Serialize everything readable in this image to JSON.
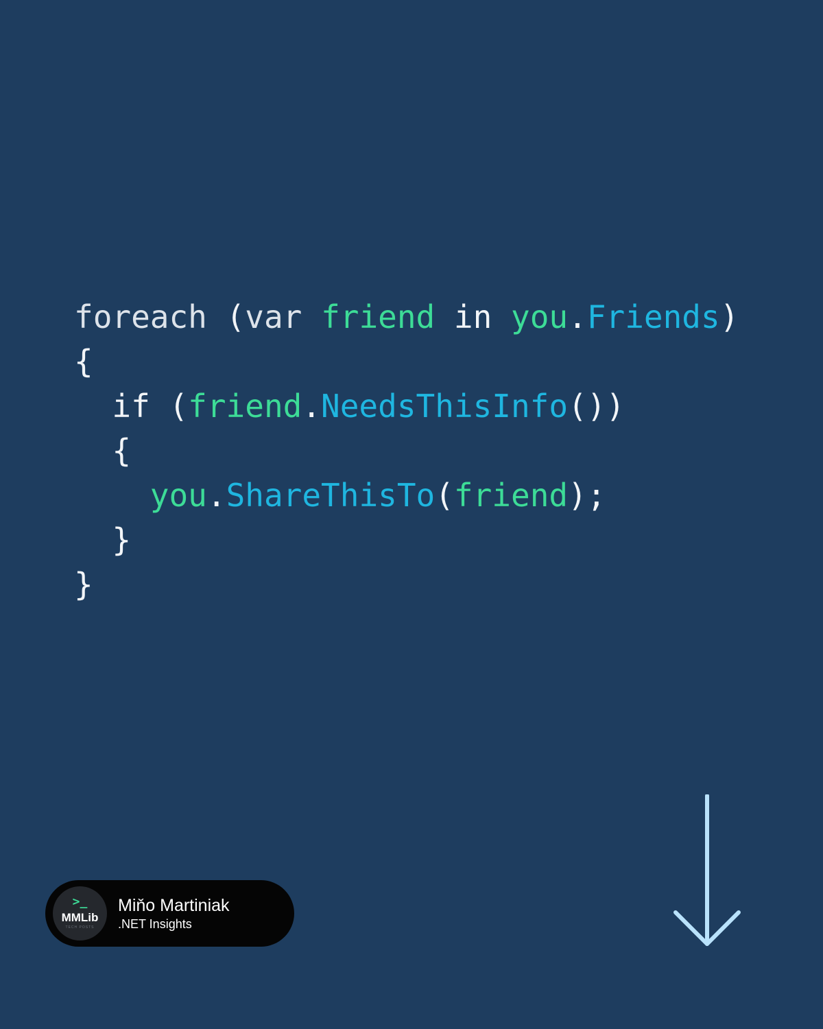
{
  "code": {
    "lines": [
      {
        "tokens": [
          {
            "t": "foreach",
            "k": "kw"
          },
          {
            "t": " (",
            "k": "plain"
          },
          {
            "t": "var",
            "k": "kw"
          },
          {
            "t": " ",
            "k": "plain"
          },
          {
            "t": "friend",
            "k": "var"
          },
          {
            "t": " in ",
            "k": "plain"
          },
          {
            "t": "you",
            "k": "var"
          },
          {
            "t": ".",
            "k": "plain"
          },
          {
            "t": "Friends",
            "k": "member"
          },
          {
            "t": ")",
            "k": "plain"
          }
        ]
      },
      {
        "tokens": [
          {
            "t": "{",
            "k": "plain"
          }
        ]
      },
      {
        "tokens": [
          {
            "t": "  if (",
            "k": "plain"
          },
          {
            "t": "friend",
            "k": "var"
          },
          {
            "t": ".",
            "k": "plain"
          },
          {
            "t": "NeedsThisInfo",
            "k": "member"
          },
          {
            "t": "())",
            "k": "plain"
          }
        ]
      },
      {
        "tokens": [
          {
            "t": "  {",
            "k": "plain"
          }
        ]
      },
      {
        "tokens": [
          {
            "t": "    ",
            "k": "plain"
          },
          {
            "t": "you",
            "k": "var"
          },
          {
            "t": ".",
            "k": "plain"
          },
          {
            "t": "ShareThisTo",
            "k": "member"
          },
          {
            "t": "(",
            "k": "plain"
          },
          {
            "t": "friend",
            "k": "var"
          },
          {
            "t": ");",
            "k": "plain"
          }
        ]
      },
      {
        "tokens": [
          {
            "t": "  }",
            "k": "plain"
          }
        ]
      },
      {
        "tokens": [
          {
            "t": "}",
            "k": "plain"
          }
        ]
      }
    ]
  },
  "author": {
    "logo_prompt": ">_",
    "logo_text": "MMLib",
    "logo_subtext": "TECH POSTS",
    "name": "Miňo Martiniak",
    "tagline": ".NET Insights"
  },
  "icons": {
    "next": "arrow-down-icon"
  },
  "colors": {
    "background": "#1e3d5f",
    "keyword": "#dde3ea",
    "variable": "#3ddc97",
    "member": "#1fb6e0",
    "arrow": "#b9e2fb"
  }
}
